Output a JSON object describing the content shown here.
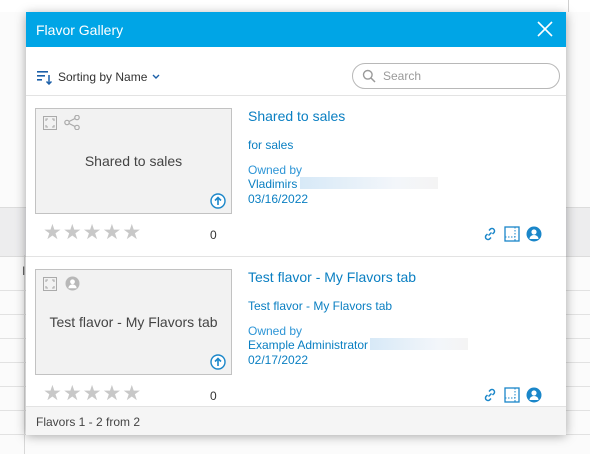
{
  "dialog": {
    "title": "Flavor Gallery"
  },
  "toolbar": {
    "sort_label": "Sorting by Name",
    "search_placeholder": "Search",
    "search_value": ""
  },
  "items": [
    {
      "thumbnail_text": "Shared to sales",
      "name": "Shared to sales",
      "description": "for sales",
      "owned_by_label": "Owned by",
      "owner": "Vladimirs",
      "date": "03/16/2022",
      "rating_stars": 0,
      "rating_count": "0",
      "thumb_icons": [
        "fullscreen-icon",
        "share-icon",
        "upload-icon"
      ]
    },
    {
      "thumbnail_text": "Test flavor - My Flavors tab",
      "name": "Test flavor - My Flavors tab",
      "description": "Test flavor - My Flavors tab",
      "owned_by_label": "Owned by",
      "owner": "Example Administrator",
      "date": "02/17/2022",
      "rating_stars": 0,
      "rating_count": "0",
      "thumb_icons": [
        "fullscreen-icon",
        "user-icon",
        "upload-icon"
      ]
    }
  ],
  "footer": {
    "status": "Flavors 1 - 2 from 2"
  },
  "background": {
    "column_label": "I"
  },
  "colors": {
    "titlebar": "#00a5e6",
    "link": "#0a7fc2",
    "action_icon": "#1a86c9"
  }
}
